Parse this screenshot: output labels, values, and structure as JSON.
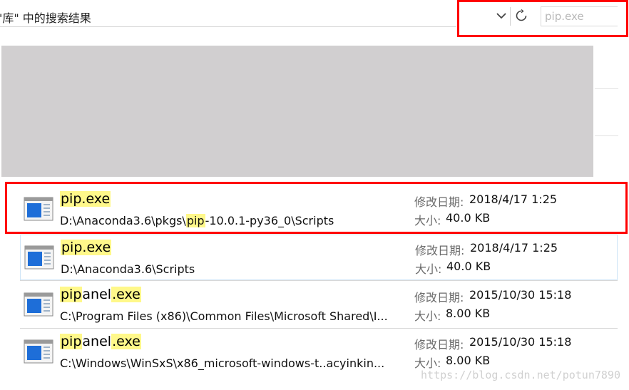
{
  "window": {
    "title": "\"库\" 中的搜索结果"
  },
  "search": {
    "value": "pip.exe",
    "placeholder": "pip.exe"
  },
  "labels": {
    "modified": "修改日期:",
    "size": "大小:"
  },
  "results": [
    {
      "name_parts": [
        {
          "text": "pip.exe",
          "hl": true
        }
      ],
      "path_parts": [
        {
          "text": "D:\\Anaconda3.6\\pkgs\\",
          "hl": false
        },
        {
          "text": "pip",
          "hl": true
        },
        {
          "text": "-10.0.1-py36_0\\Scripts",
          "hl": false
        }
      ],
      "modified": "2018/4/17 1:25",
      "size": "40.0 KB"
    },
    {
      "name_parts": [
        {
          "text": "pip.exe",
          "hl": true
        }
      ],
      "path_parts": [
        {
          "text": "D:\\Anaconda3.6\\Scripts",
          "hl": false
        }
      ],
      "modified": "2018/4/17 1:25",
      "size": "40.0 KB"
    },
    {
      "name_parts": [
        {
          "text": "pip",
          "hl": true
        },
        {
          "text": "anel",
          "hl": false
        },
        {
          "text": ".exe",
          "hl": true
        }
      ],
      "path_parts": [
        {
          "text": "C:\\Program Files (x86)\\Common Files\\Microsoft Shared\\I...",
          "hl": false
        }
      ],
      "modified": "2015/10/30 15:18",
      "size": "8.00 KB"
    },
    {
      "name_parts": [
        {
          "text": "pip",
          "hl": true
        },
        {
          "text": "anel",
          "hl": false
        },
        {
          "text": ".exe",
          "hl": true
        }
      ],
      "path_parts": [
        {
          "text": "C:\\Windows\\WinSxS\\x86_microsoft-windows-t..acyinkin...",
          "hl": false
        }
      ],
      "modified": "2015/10/30 15:18",
      "size": "8.00 KB"
    }
  ],
  "watermark": "https://blog.csdn.net/potun7890",
  "colors": {
    "highlight": "#fff88a",
    "annotation_red": "#ff0000",
    "redacted_block": "#d1cfd0"
  },
  "icons": [
    "chevron-down-icon",
    "refresh-icon",
    "exe-file-icon"
  ]
}
